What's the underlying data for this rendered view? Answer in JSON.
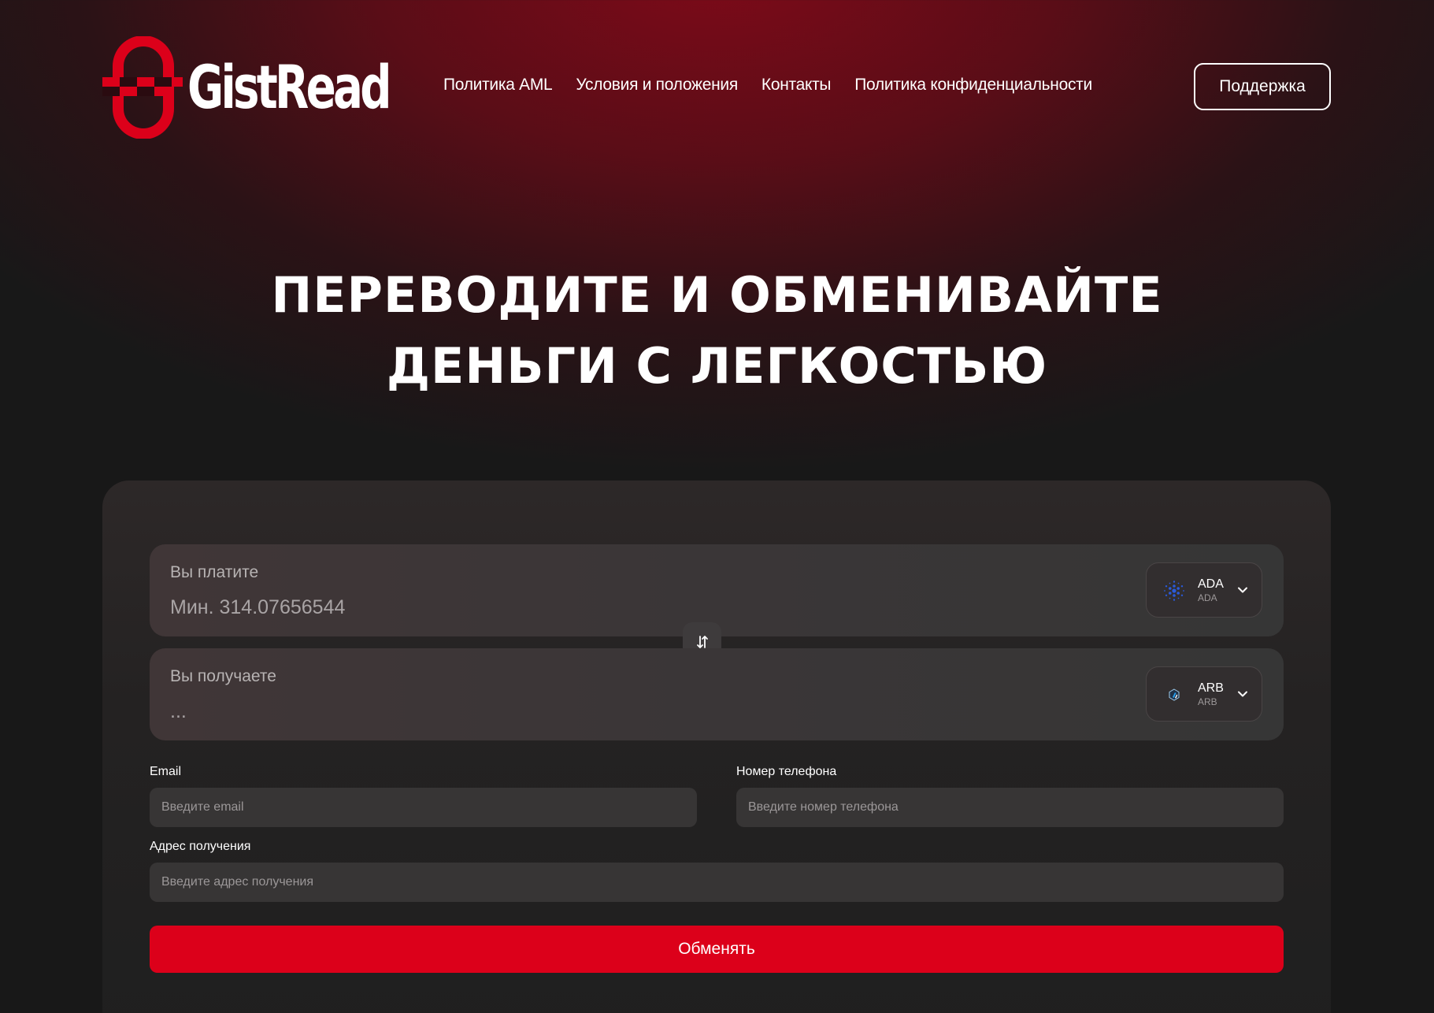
{
  "brand": {
    "name": "GistRead",
    "accent_color": "#dc001a"
  },
  "nav": {
    "items": [
      {
        "label": "Политика AML"
      },
      {
        "label": "Условия и положения"
      },
      {
        "label": "Контакты"
      },
      {
        "label": "Политика конфиденциальности"
      }
    ],
    "support_label": "Поддержка"
  },
  "hero": {
    "line1": "ПЕРЕВОДИТЕ И ОБМЕНИВАЙТЕ",
    "line2": "ДЕНЬГИ С ЛЕГКОСТЬЮ"
  },
  "exchange": {
    "pay": {
      "label": "Вы платите",
      "value": "Мин. 314.07656544",
      "coin": {
        "name": "ADA",
        "sub": "ADA",
        "icon": "cardano-icon",
        "color": "#2a5ada"
      }
    },
    "receive": {
      "label": "Вы получаете",
      "value": "...",
      "coin": {
        "name": "ARB",
        "sub": "ARB",
        "icon": "arbitrum-icon",
        "color": "#28a0f0"
      }
    },
    "swap_icon": "swap-arrows-icon"
  },
  "form": {
    "email": {
      "label": "Email",
      "placeholder": "Введите email"
    },
    "phone": {
      "label": "Номер телефона",
      "placeholder": "Введите номер телефона"
    },
    "address": {
      "label": "Адрес получения",
      "placeholder": "Введите адрес получения"
    },
    "submit_label": "Обменять"
  }
}
